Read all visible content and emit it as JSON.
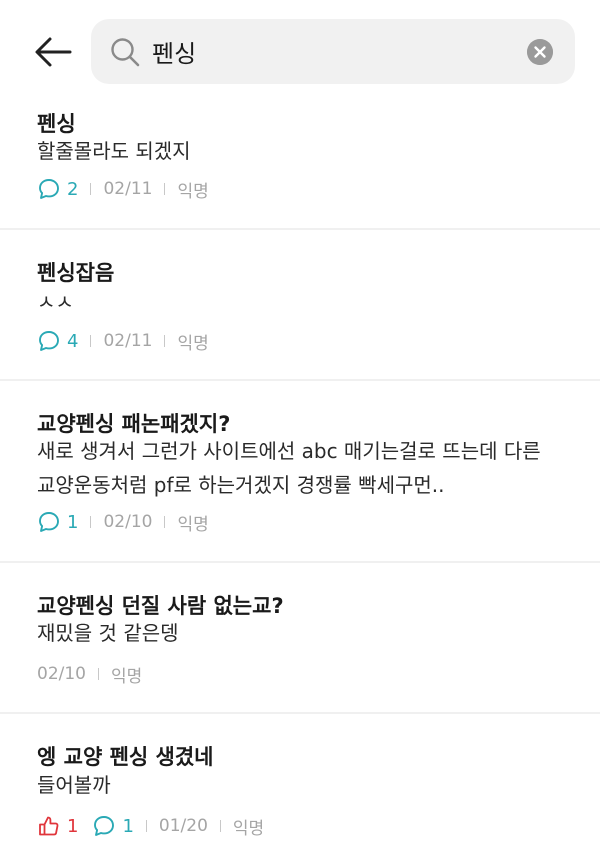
{
  "search": {
    "query": "펜싱"
  },
  "posts": [
    {
      "title": "펜싱",
      "body": [
        "할줄몰라도 되겠지"
      ],
      "likes": null,
      "comments": "2",
      "date": "02/11",
      "author": "익명"
    },
    {
      "title": "펜싱잡음",
      "body": [
        "ㅅㅅ"
      ],
      "likes": null,
      "comments": "4",
      "date": "02/11",
      "author": "익명"
    },
    {
      "title": "교양펜싱 패논패겠지?",
      "body": [
        "새로 생겨서 그런가 사이트에선 abc 매기는걸로 뜨는데 다른",
        "교양운동처럼 pf로 하는거겠지 경쟁률 빡세구먼.."
      ],
      "likes": null,
      "comments": "1",
      "date": "02/10",
      "author": "익명"
    },
    {
      "title": "교양펜싱 던질 사람 없는교?",
      "body": [
        "재밌을 것 같은뎅"
      ],
      "likes": null,
      "comments": null,
      "date": "02/10",
      "author": "익명"
    },
    {
      "title": "엥 교양 펜싱 생겼네",
      "body": [
        "들어볼까"
      ],
      "likes": "1",
      "comments": "1",
      "date": "01/20",
      "author": "익명"
    }
  ],
  "colors": {
    "comment": "#2aa9b5",
    "like": "#e0353b",
    "meta": "#a5a5a5"
  },
  "icons": {
    "back": "arrow-left-icon",
    "search": "magnifier-icon",
    "clear": "clear-x-icon",
    "comment": "speech-bubble-icon",
    "like": "thumbs-up-icon"
  }
}
